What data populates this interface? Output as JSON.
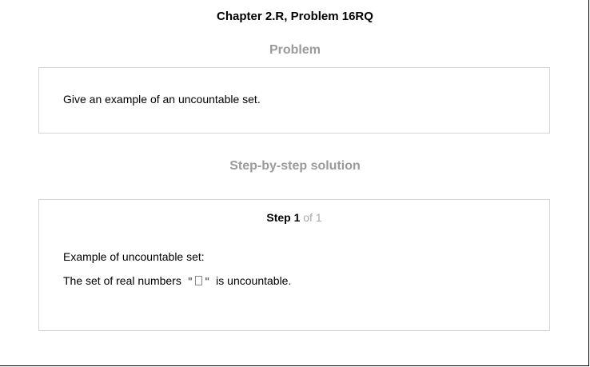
{
  "header": {
    "chapter_title": "Chapter 2.R, Problem 16RQ"
  },
  "problem": {
    "heading": "Problem",
    "text": "Give an example of an uncountable set."
  },
  "solution": {
    "heading": "Step-by-step solution",
    "step": {
      "label": "Step 1",
      "of_text": "of 1",
      "line1": "Example of uncountable set:",
      "line2_prefix": "The set of real numbers",
      "quote_open": "\"",
      "quote_close": "\"",
      "line2_suffix": "is uncountable."
    }
  }
}
